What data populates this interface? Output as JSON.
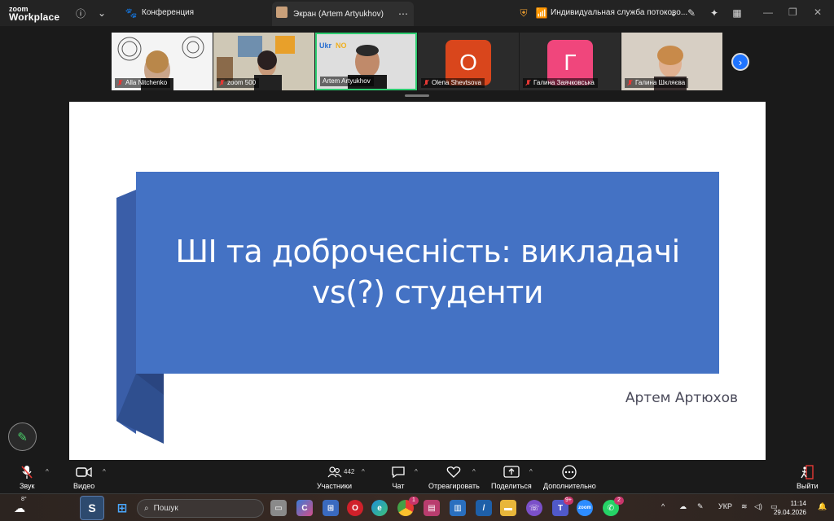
{
  "app": {
    "logo_line1": "zoom",
    "logo_line2": "Workplace",
    "meeting_label": "Конференция",
    "screen_tab_label": "Экран (Artem Artyukhov)",
    "service_label": "Индивидуальная служба потоково..."
  },
  "participants": [
    {
      "name": "Alla Nitchenko",
      "muted": true,
      "type": "video"
    },
    {
      "name": "zoom 500",
      "muted": true,
      "type": "video"
    },
    {
      "name": "Artem Artyukhov",
      "muted": false,
      "type": "video",
      "active": true
    },
    {
      "name": "Olena Shevtsova",
      "muted": true,
      "type": "avatar",
      "initial": "O",
      "color": "#d9461c"
    },
    {
      "name": "Галина Заячковська",
      "muted": true,
      "type": "avatar",
      "initial": "Г",
      "color": "#f0467c"
    },
    {
      "name": "Галина Шкляєва",
      "muted": true,
      "type": "video"
    }
  ],
  "slide": {
    "title": "ШІ та доброчесність: викладачі vs(?) студенти",
    "author": "Артем Артюхов"
  },
  "toolbar": {
    "audio": "Звук",
    "video": "Видео",
    "participants": "Участники",
    "participants_count": "442",
    "chat": "Чат",
    "react": "Отреагировать",
    "share": "Поделиться",
    "more": "Дополнительно",
    "leave": "Выйти"
  },
  "taskbar": {
    "weather_temp": "8°",
    "search_placeholder": "Пошук",
    "lang": "УКР",
    "time": "11:14",
    "date": "29.04.2026",
    "teams_badge": "9+",
    "whatsapp_badge": "2",
    "chrome_badge": "1"
  },
  "colors": {
    "slide_blue": "#4472c4",
    "ribbon_dark": "#2f4f8f",
    "active_border": "#2ecc71",
    "zoom_blue": "#1f74ff"
  }
}
